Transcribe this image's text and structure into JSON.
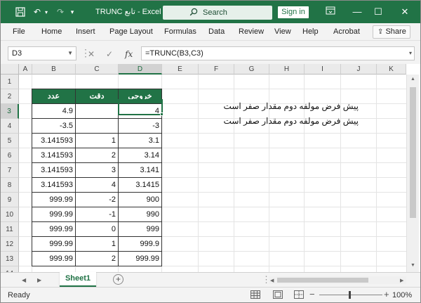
{
  "titlebar": {
    "title": "TRUNC تابع - Excel",
    "search_placeholder": "Search",
    "signin_label": "Sign in",
    "autosave_icon": "save-icon",
    "minimize_glyph": "—",
    "restore_glyph": "☐",
    "close_glyph": "✕"
  },
  "menu": {
    "items": [
      "File",
      "Home",
      "Insert",
      "Page Layout",
      "Formulas",
      "Data",
      "Review",
      "View",
      "Help",
      "Acrobat"
    ],
    "share_label": "Share"
  },
  "formula_bar": {
    "name_box": "D3",
    "fx_label": "fx",
    "formula": "=TRUNC(B3,C3)"
  },
  "columns": [
    "A",
    "B",
    "C",
    "D",
    "E",
    "F",
    "G",
    "H",
    "I",
    "J",
    "K"
  ],
  "rows": [
    "1",
    "2",
    "3",
    "4",
    "5",
    "6",
    "7",
    "8",
    "9",
    "10",
    "11",
    "12",
    "13",
    "14"
  ],
  "table": {
    "headers": [
      "عدد",
      "دقت",
      "خروجی"
    ],
    "rows": [
      [
        "4.9",
        "",
        "4"
      ],
      [
        "-3.5",
        "",
        "-3"
      ],
      [
        "3.141593",
        "1",
        "3.1"
      ],
      [
        "3.141593",
        "2",
        "3.14"
      ],
      [
        "3.141593",
        "3",
        "3.141"
      ],
      [
        "3.141593",
        "4",
        "3.1415"
      ],
      [
        "999.99",
        "-2",
        "900"
      ],
      [
        "999.99",
        "-1",
        "990"
      ],
      [
        "999.99",
        "0",
        "999"
      ],
      [
        "999.99",
        "1",
        "999.9"
      ],
      [
        "999.99",
        "2",
        "999.99"
      ]
    ]
  },
  "notes": [
    "پیش فرض مولفه دوم مقدار صفر است",
    "پیش فرض مولفه دوم مقدار صفر است"
  ],
  "sheet_tab": "Sheet1",
  "status": {
    "ready": "Ready",
    "zoom": "100%"
  },
  "accent_color": "#217346"
}
